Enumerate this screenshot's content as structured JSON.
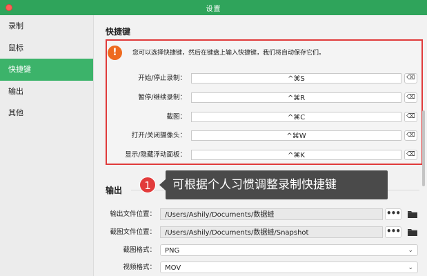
{
  "window": {
    "title": "设置"
  },
  "sidebar": {
    "items": [
      {
        "label": "录制"
      },
      {
        "label": "鼠标"
      },
      {
        "label": "快捷键",
        "active": true
      },
      {
        "label": "输出"
      },
      {
        "label": "其他"
      }
    ]
  },
  "shortcuts": {
    "title": "快捷键",
    "notice": "您可以选择快捷键，然后在键盘上输入快捷键，我们将自动保存它们。",
    "items": [
      {
        "label": "开始/停止录制：",
        "value": "^⌘S"
      },
      {
        "label": "暂停/继续录制：",
        "value": "^⌘R"
      },
      {
        "label": "截图：",
        "value": "^⌘C"
      },
      {
        "label": "打开/关闭摄像头：",
        "value": "^⌘W"
      },
      {
        "label": "显示/隐藏浮动面板：",
        "value": "^⌘K"
      }
    ],
    "clear_icon": "⌫"
  },
  "callout": {
    "badge": "1",
    "text": "可根据个人习惯调整录制快捷键"
  },
  "output": {
    "title": "输出",
    "output_path_label": "输出文件位置：",
    "output_path": "/Users/Ashily/Documents/数据蛙",
    "screenshot_path_label": "截图文件位置：",
    "screenshot_path": "/Users/Ashily/Documents/数据蛙/Snapshot",
    "browse_label": "•••",
    "image_format_label": "截图格式：",
    "image_format": "PNG",
    "video_format_label": "视频格式：",
    "video_format": "MOV"
  },
  "colors": {
    "accent": "#3cb36a",
    "titlebar": "#2fa45b",
    "highlight_border": "#e03a3a",
    "warning": "#ee6a1f"
  }
}
